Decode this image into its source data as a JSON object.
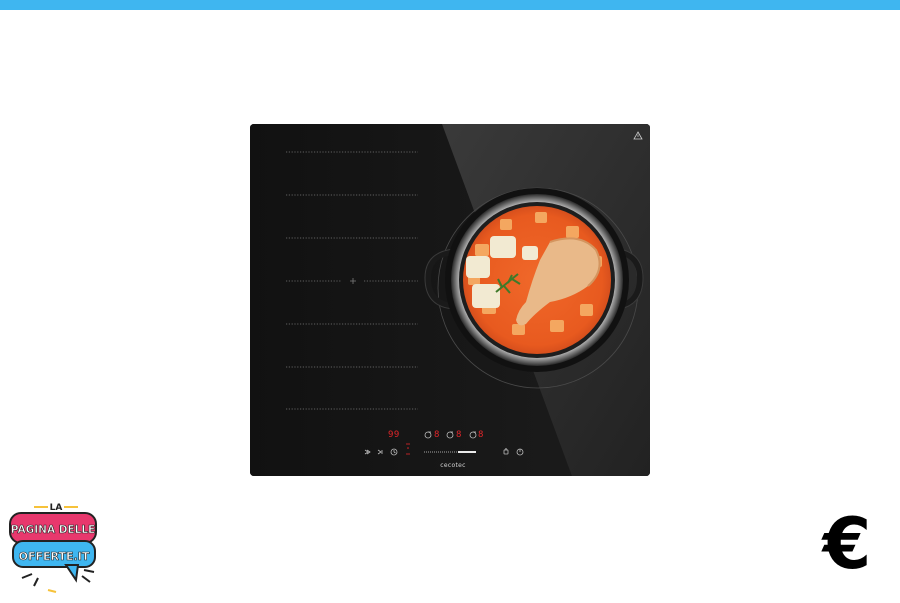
{
  "colors": {
    "top_bar": "#3fb6f0",
    "hob_glass": "#141414",
    "display_red": "#e2262a",
    "logo_pink": "#e8386d",
    "logo_cyan": "#3fb6f0",
    "logo_yellow": "#f6c23a"
  },
  "hob": {
    "timer_display": "99",
    "zone_displays": [
      "8",
      "8",
      "8"
    ],
    "brand": "cecotec"
  },
  "logo": {
    "line1": "LA",
    "line2": "PAGINA DELLE",
    "line3": "OFFERTE.IT"
  },
  "currency_symbol": "€"
}
